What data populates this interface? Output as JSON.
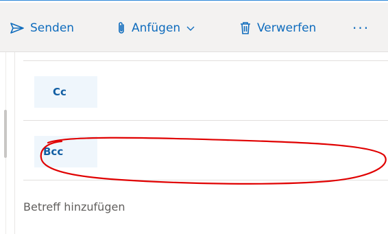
{
  "toolbar": {
    "send_label": "Senden",
    "send_icon": "send-icon",
    "attach_label": "Anfügen",
    "attach_icon": "paperclip-icon",
    "discard_label": "Verwerfen",
    "discard_icon": "trash-icon",
    "more_label": "···",
    "accent_color": "#0f6cbd"
  },
  "recipients": {
    "cc_label": "Cc",
    "bcc_label": "Bcc"
  },
  "subject": {
    "placeholder": "Betreff hinzufügen"
  },
  "annotation": {
    "color": "#e00000",
    "shape": "hand-drawn-ellipse-around-bcc"
  }
}
